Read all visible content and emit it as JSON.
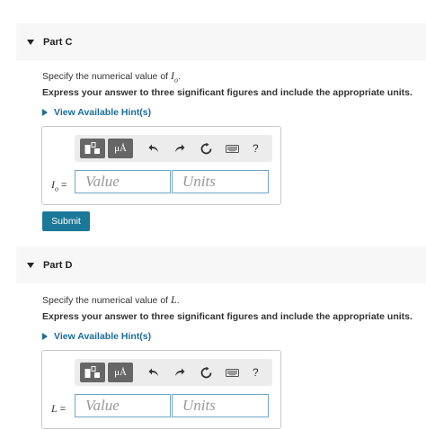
{
  "part_c": {
    "title": "Part C",
    "question_prefix": "Specify the numerical value of ",
    "question_var": "I",
    "question_var_sub": "o",
    "question_suffix": ".",
    "instructions": "Express your answer to three significant figures and include the appropriate units.",
    "hint_label": "View Available Hint(s)",
    "var_label": "I",
    "var_label_sub": "o",
    "equals": " =",
    "value_placeholder": "Value",
    "units_placeholder": "Units",
    "submit_label": "Submit"
  },
  "part_d": {
    "title": "Part D",
    "question_prefix": "Specify the numerical value of ",
    "question_var": "L",
    "question_suffix": ".",
    "instructions": "Express your answer to three significant figures and include the appropriate units.",
    "hint_label": "View Available Hint(s)",
    "var_label": "L",
    "equals": " =",
    "value_placeholder": "Value",
    "units_placeholder": "Units"
  },
  "toolbar": {
    "units_button_label": "μÅ",
    "help_label": "?",
    "icons": [
      "template-icon",
      "undo-icon",
      "redo-icon",
      "reset-icon",
      "keyboard-icon"
    ]
  }
}
